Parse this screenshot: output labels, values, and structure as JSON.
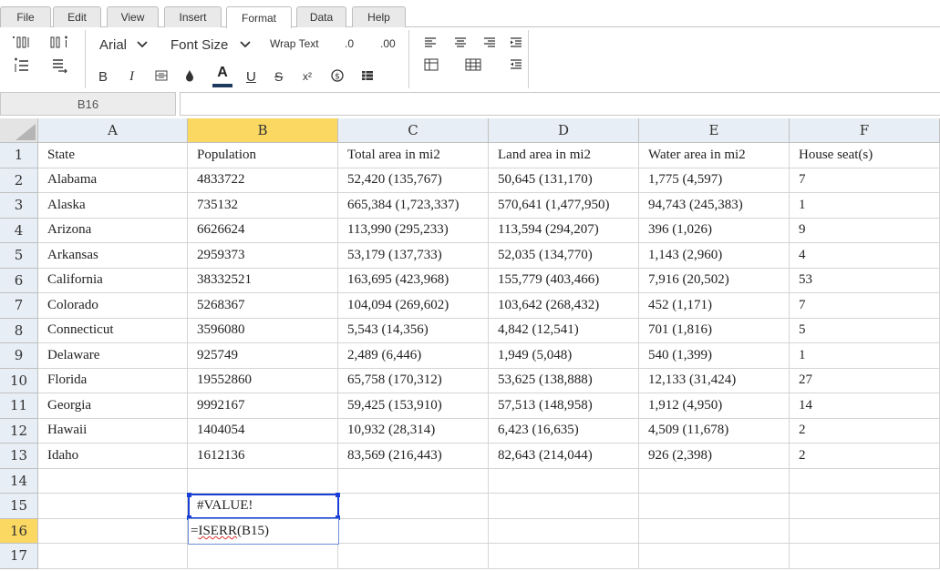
{
  "menu": {
    "tabs": [
      {
        "label": "File"
      },
      {
        "label": "Edit"
      },
      {
        "label": "View"
      },
      {
        "label": "Insert"
      },
      {
        "label": "Format"
      },
      {
        "label": "Data"
      },
      {
        "label": "Help"
      }
    ],
    "active_tab": "Format"
  },
  "toolbar": {
    "font_name": "Arial",
    "font_size_label": "Font Size",
    "wrap_text_label": "Wrap Text",
    "decrease_decimal_label": ".0",
    "increase_decimal_label": ".00",
    "bold_label": "B",
    "italic_label": "I",
    "underline_label": "U",
    "strikethrough_label": "S",
    "superscript_label": "x²",
    "text_color_label": "A",
    "text_color": "#1f3a5f"
  },
  "formula_bar": {
    "cell_reference": "B16",
    "formula": ""
  },
  "grid": {
    "columns": [
      "A",
      "B",
      "C",
      "D",
      "E",
      "F"
    ],
    "selected_column": "B",
    "row_numbers": [
      "1",
      "2",
      "3",
      "4",
      "5",
      "6",
      "7",
      "8",
      "9",
      "10",
      "11",
      "12",
      "13",
      "14",
      "15",
      "16",
      "17"
    ],
    "selected_row": "16",
    "rows": [
      [
        "State",
        "Population",
        "Total area in mi2",
        "Land area in mi2",
        "Water area in mi2",
        "House seat(s)"
      ],
      [
        "Alabama",
        "4833722",
        "52,420 (135,767)",
        "50,645 (131,170)",
        "1,775 (4,597)",
        "7"
      ],
      [
        "Alaska",
        "735132",
        "665,384 (1,723,337)",
        "570,641 (1,477,950)",
        "94,743 (245,383)",
        "1"
      ],
      [
        "Arizona",
        "6626624",
        "113,990 (295,233)",
        "113,594 (294,207)",
        "396 (1,026)",
        "9"
      ],
      [
        "Arkansas",
        "2959373",
        "53,179 (137,733)",
        "52,035 (134,770)",
        "1,143 (2,960)",
        "4"
      ],
      [
        "California",
        "38332521",
        "163,695 (423,968)",
        "155,779 (403,466)",
        "7,916 (20,502)",
        "53"
      ],
      [
        "Colorado",
        "5268367",
        "104,094 (269,602)",
        "103,642 (268,432)",
        "452 (1,171)",
        "7"
      ],
      [
        "Connecticut",
        "3596080",
        "5,543 (14,356)",
        "4,842 (12,541)",
        "701 (1,816)",
        "5"
      ],
      [
        "Delaware",
        "925749",
        "2,489 (6,446)",
        "1,949 (5,048)",
        "540 (1,399)",
        "1"
      ],
      [
        "Florida",
        "19552860",
        "65,758 (170,312)",
        "53,625 (138,888)",
        "12,133 (31,424)",
        "27"
      ],
      [
        "Georgia",
        "9992167",
        "59,425 (153,910)",
        "57,513 (148,958)",
        "1,912 (4,950)",
        "14"
      ],
      [
        "Hawaii",
        "1404054",
        "10,932 (28,314)",
        "6,423 (16,635)",
        "4,509 (11,678)",
        "2"
      ],
      [
        "Idaho",
        "1612136",
        "83,569 (216,443)",
        "82,643 (214,044)",
        "926 (2,398)",
        "2"
      ],
      [
        "",
        "",
        "",
        "",
        "",
        ""
      ],
      [
        "",
        "#VALUE!",
        "",
        "",
        "",
        ""
      ],
      [
        "",
        "",
        "",
        "",
        "",
        ""
      ],
      [
        "",
        "",
        "",
        "",
        "",
        ""
      ]
    ],
    "editing_cell": {
      "ref": "B16",
      "prefix": "=",
      "function_name": "ISERR",
      "args": "(B15)"
    }
  },
  "colors": {
    "selection_border": "#1a3fd6",
    "header_selected": "#fbd862",
    "header_bg": "#e8eef5"
  }
}
